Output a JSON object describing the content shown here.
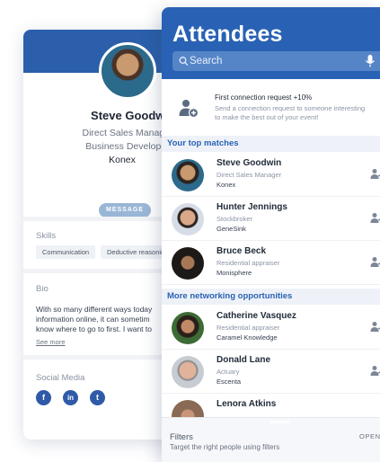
{
  "profile": {
    "name": "Steve Goodwin",
    "title": "Direct Sales Manager",
    "department": "Business Developer",
    "company": "Konex",
    "message_button": "MESSAGE",
    "skills_heading": "Skills",
    "skills": [
      "Communication",
      "Deductive reasoning"
    ],
    "bio_heading": "Bio",
    "bio_lines": [
      "With so many different ways today",
      "information online, it can sometim",
      "know where to go to first. I want to"
    ],
    "see_more": "See more",
    "social_heading": "Social Media",
    "social": [
      {
        "icon": "facebook-icon",
        "glyph": "f",
        "color": "#2f5aa8"
      },
      {
        "icon": "linkedin-icon",
        "glyph": "in",
        "color": "#2f5aa8"
      },
      {
        "icon": "twitter-icon",
        "glyph": "t",
        "color": "#2f5aa8"
      }
    ]
  },
  "attendees": {
    "title": "Attendees",
    "search_placeholder": "Search",
    "promo": {
      "title": "First connection request +10%",
      "description_lines": [
        "Send a connection request to someone interesting",
        "to make the best out of your event!"
      ]
    },
    "groups": [
      {
        "heading": "Your top matches",
        "people": [
          {
            "name": "Steve Goodwin",
            "role": "Direct Sales Manager",
            "company": "Konex",
            "avatar": "#2c6a8c"
          },
          {
            "name": "Hunter Jennings",
            "role": "Stockbroker",
            "company": "GeneSink",
            "avatar": "#d7dde6"
          },
          {
            "name": "Bruce Beck",
            "role": "Residential appraiser",
            "company": "Monisphere",
            "avatar": "#2a2522"
          }
        ]
      },
      {
        "heading": "More networking opportunities",
        "people": [
          {
            "name": "Catherine Vasquez",
            "role": "Residential appraiser",
            "company": "Caramel Knowledge",
            "avatar": "#3d6b35"
          },
          {
            "name": "Donald Lane",
            "role": "Actuary",
            "company": "Escenta",
            "avatar": "#c7ccd3"
          },
          {
            "name": "Lenora Atkins",
            "role": "",
            "company": "",
            "avatar": "#8a6a55"
          }
        ]
      }
    ],
    "filters": {
      "title": "Filters",
      "description": "Target the right people using filters",
      "open_label": "OPEN"
    }
  },
  "colors": {
    "primary_blue": "#2962b4",
    "search_blue": "#5585c7",
    "group_header_bg": "#eef2f8"
  }
}
